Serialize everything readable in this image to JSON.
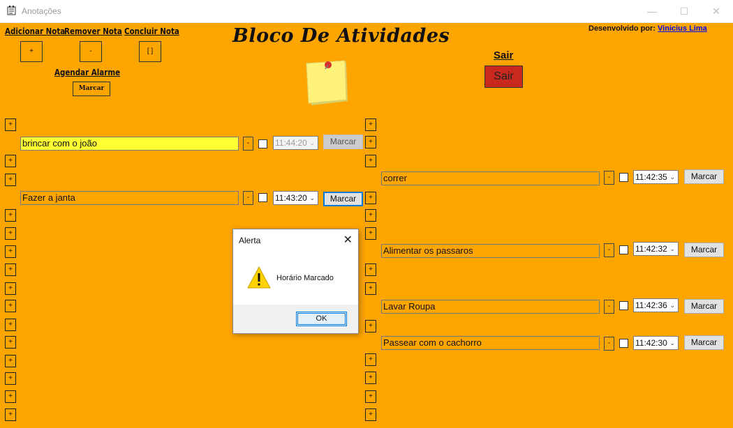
{
  "window": {
    "title": "Anotações"
  },
  "header": {
    "title": "Bloco De Atividades",
    "dev_prefix": "Desenvolvido por:",
    "dev_name": "Vinicius Lima"
  },
  "toolbar": {
    "add_label": "Adicionar Nota",
    "add_btn": "+",
    "remove_label": "Remover Nota",
    "remove_btn": "-",
    "conclude_label": "Concluir Nota",
    "conclude_btn": "[ ]",
    "alarm_label": "Agendar Alarme",
    "alarm_btn": "Marcar",
    "exit_label": "Sair",
    "exit_btn": "Sair"
  },
  "plus_symbol": "+",
  "minus_symbol": "-",
  "notes": [
    {
      "text": "brincar com o joão",
      "time": "11:44:20",
      "marcar": "Marcar",
      "highlighted": true,
      "disabled": true
    },
    {
      "text": "Fazer a janta",
      "time": "11:43:20",
      "marcar": "Marcar"
    },
    {
      "text": "correr",
      "time": "11:42:35",
      "marcar": "Marcar"
    },
    {
      "text": "Alimentar os passaros",
      "time": "11:42:32",
      "marcar": "Marcar"
    },
    {
      "text": "Lavar Roupa",
      "time": "11:42:36",
      "marcar": "Marcar"
    },
    {
      "text": "Passear com o cachorro",
      "time": "11:42:30",
      "marcar": "Marcar"
    }
  ],
  "dialog": {
    "title": "Alerta",
    "message": "Horário Marcado",
    "ok": "OK"
  },
  "colors": {
    "background": "#ffa500",
    "exit_button": "#c8281e",
    "highlight": "#ffff32"
  }
}
